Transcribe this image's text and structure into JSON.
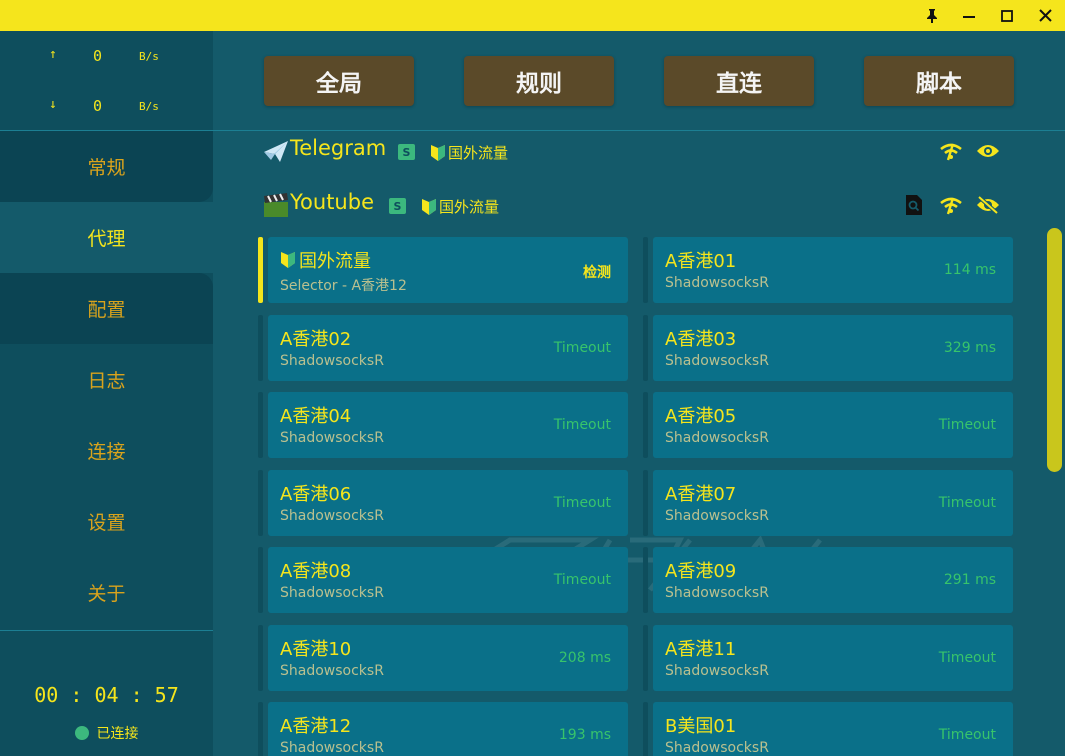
{
  "window": {
    "controls": [
      "pin-icon",
      "minimize-icon",
      "maximize-icon",
      "close-icon"
    ]
  },
  "traffic": {
    "upload": {
      "arrow": "↑",
      "value": "0",
      "unit": "B/s"
    },
    "download": {
      "arrow": "↓",
      "value": "0",
      "unit": "B/s"
    }
  },
  "nav": {
    "items": [
      {
        "label": "常规"
      },
      {
        "label": "代理"
      },
      {
        "label": "配置"
      },
      {
        "label": "日志"
      },
      {
        "label": "连接"
      },
      {
        "label": "设置"
      },
      {
        "label": "关于"
      }
    ],
    "active_index": 1
  },
  "status": {
    "elapsed": "00 : 04 : 57",
    "connection": "已连接"
  },
  "modes": [
    "全局",
    "规则",
    "直连",
    "脚本"
  ],
  "groups": [
    {
      "name": "Telegram",
      "badge": "S",
      "selected_tag": "国外流量",
      "emoji": "airplane-icon"
    },
    {
      "name": "Youtube",
      "badge": "S",
      "selected_tag": "国外流量",
      "emoji": "clapper-icon"
    }
  ],
  "proxies": [
    {
      "name": "国外流量",
      "type": "Selector - A香港12",
      "delay": "",
      "action": "检测",
      "selected": true,
      "beginner_icon": true
    },
    {
      "name": "A香港01",
      "type": "ShadowsocksR",
      "delay": "114 ms"
    },
    {
      "name": "A香港02",
      "type": "ShadowsocksR",
      "delay": "Timeout"
    },
    {
      "name": "A香港03",
      "type": "ShadowsocksR",
      "delay": "329 ms"
    },
    {
      "name": "A香港04",
      "type": "ShadowsocksR",
      "delay": "Timeout"
    },
    {
      "name": "A香港05",
      "type": "ShadowsocksR",
      "delay": "Timeout"
    },
    {
      "name": "A香港06",
      "type": "ShadowsocksR",
      "delay": "Timeout"
    },
    {
      "name": "A香港07",
      "type": "ShadowsocksR",
      "delay": "Timeout"
    },
    {
      "name": "A香港08",
      "type": "ShadowsocksR",
      "delay": "Timeout"
    },
    {
      "name": "A香港09",
      "type": "ShadowsocksR",
      "delay": "291 ms"
    },
    {
      "name": "A香港10",
      "type": "ShadowsocksR",
      "delay": "208 ms"
    },
    {
      "name": "A香港11",
      "type": "ShadowsocksR",
      "delay": "Timeout"
    },
    {
      "name": "A香港12",
      "type": "ShadowsocksR",
      "delay": "193 ms"
    },
    {
      "name": "B美国01",
      "type": "ShadowsocksR",
      "delay": "Timeout"
    }
  ],
  "colors": {
    "accent": "#f5e51c",
    "sidebar": "#0e4e5d",
    "main": "#145a6a",
    "card": "#0a7089",
    "mode_button": "#5b4a29",
    "delay_ok": "#37c46b",
    "connected": "#3cb87e"
  }
}
